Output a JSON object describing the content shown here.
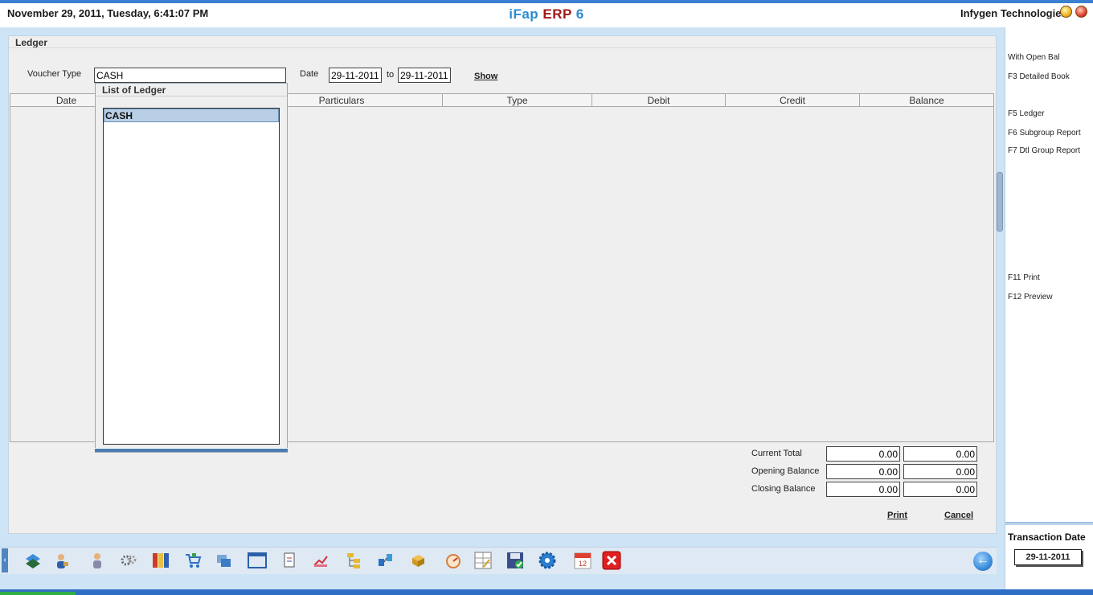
{
  "titlebar": {
    "datetime": "November  29, 2011, Tuesday, 6:41:07 PM",
    "app_part1": "iFap ",
    "app_part2": "ERP",
    "app_part3": " 6",
    "company": "Infygen Technologies"
  },
  "panel": {
    "title": "Ledger",
    "voucher_type_label": "Voucher Type",
    "voucher_type_value": "CASH",
    "date_label": "Date",
    "date_from": "29-11-2011",
    "to_label": "to",
    "date_to": "29-11-2011",
    "show_label": "Show"
  },
  "table": {
    "columns": [
      "Date",
      "Particulars",
      "Type",
      "Debit",
      "Credit",
      "Balance"
    ]
  },
  "popup": {
    "title": "List of Ledger",
    "items": [
      "CASH"
    ]
  },
  "totals": {
    "current_total_label": "Current Total",
    "current_debit": "0.00",
    "current_credit": "0.00",
    "opening_balance_label": "Opening Balance",
    "opening_debit": "0.00",
    "opening_credit": "0.00",
    "closing_balance_label": "Closing Balance",
    "closing_debit": "0.00",
    "closing_credit": "0.00",
    "print_label": "Print",
    "cancel_label": "Cancel"
  },
  "right_menu": {
    "items": [
      "With Open Bal",
      "F3 Detailed Book",
      "F5 Ledger",
      "F6 Subgroup Report",
      "F7 Dtl Group Report",
      "F11 Print",
      "F12 Preview"
    ],
    "transaction_date_label": "Transaction Date",
    "transaction_date": "29-11-2011"
  },
  "toolbar": {
    "icons": [
      "accounts-icon",
      "user-icon",
      "staff-icon",
      "settings-cog-icon",
      "books-icon",
      "cart-icon",
      "transfer-icon",
      "window-icon",
      "document-icon",
      "chart-icon",
      "folder-tree-icon",
      "network-icon",
      "box-icon",
      "dial-icon",
      "calculator-icon",
      "save-icon",
      "gear-icon",
      "calendar-icon",
      "close-icon"
    ],
    "calendar_day": "12"
  },
  "colors": {
    "accent_blue": "#2b8bd0",
    "erp_red": "#a01818",
    "workspace_bg": "#cde4f6"
  }
}
